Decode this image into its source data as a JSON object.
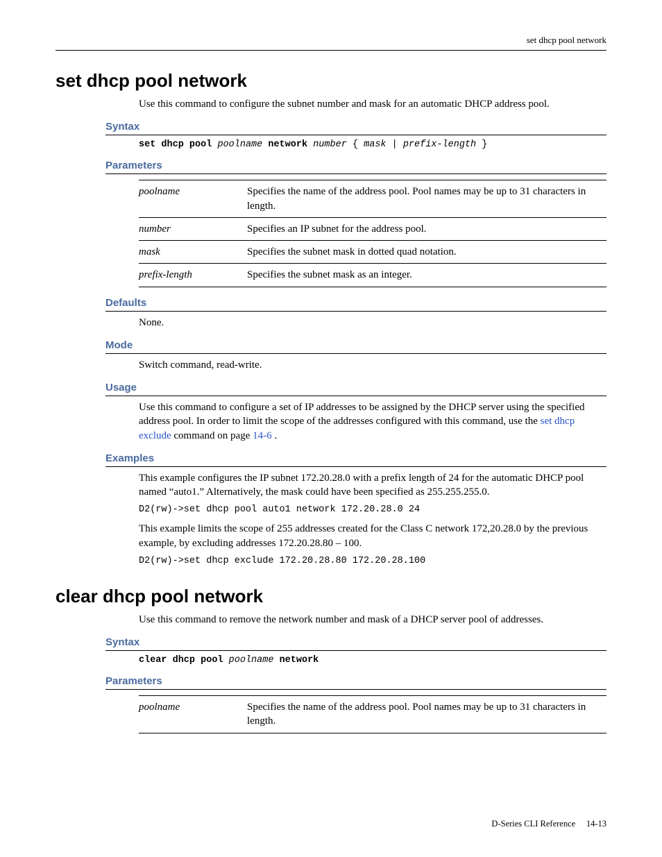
{
  "running_header": "set dhcp pool network",
  "cmd1": {
    "title": "set dhcp pool network",
    "intro": "Use this command to configure the subnet number and mask for an automatic DHCP address pool.",
    "syntax_heading": "Syntax",
    "syntax": {
      "kw1": "set dhcp pool",
      "arg1": "poolname",
      "kw2": "network",
      "arg2": "number",
      "brace_open": " {",
      "arg3": "mask",
      "pipe": " | ",
      "arg4": "prefix-length",
      "brace_close": "}"
    },
    "parameters_heading": "Parameters",
    "params": [
      {
        "name": "poolname",
        "desc": "Specifies the name of the address pool. Pool names may be up to 31 characters in length."
      },
      {
        "name": "number",
        "desc": "Specifies an IP subnet for the address pool."
      },
      {
        "name": "mask",
        "desc": "Specifies the subnet mask in dotted quad notation."
      },
      {
        "name": "prefix-length",
        "desc": "Specifies the subnet mask as an integer."
      }
    ],
    "defaults_heading": "Defaults",
    "defaults_body": "None.",
    "mode_heading": "Mode",
    "mode_body": "Switch command, read-write.",
    "usage_heading": "Usage",
    "usage_pre": "Use this command to configure a set of IP addresses to be assigned by the DHCP server using the specified address pool. In order to limit the scope of the addresses configured with this command, use the ",
    "usage_link": "set dhcp exclude",
    "usage_post1": " command on page ",
    "usage_pageref": "14-6",
    "usage_post2": ".",
    "examples_heading": "Examples",
    "example_p1": "This example configures the IP subnet 172.20.28.0 with a prefix length of 24 for the automatic DHCP pool named “auto1.” Alternatively, the mask could have been specified as 255.255.255.0.",
    "example_code1": "D2(rw)->set dhcp pool auto1 network 172.20.28.0 24",
    "example_p2": "This example limits the scope of 255 addresses created for the Class C network 172,20.28.0 by the previous example, by excluding addresses 172.20.28.80 – 100.",
    "example_code2": "D2(rw)->set dhcp exclude 172.20.28.80 172.20.28.100"
  },
  "cmd2": {
    "title": "clear dhcp pool network",
    "intro": "Use this command to remove the network number and mask of a DHCP server pool of addresses.",
    "syntax_heading": "Syntax",
    "syntax": {
      "kw1": "clear dhcp pool",
      "arg1": "poolname",
      "kw2": "network"
    },
    "parameters_heading": "Parameters",
    "params": [
      {
        "name": "poolname",
        "desc": "Specifies the name of the address pool. Pool names may be up to 31 characters in length."
      }
    ]
  },
  "footer": {
    "doc": "D-Series CLI Reference",
    "page": "14-13"
  }
}
